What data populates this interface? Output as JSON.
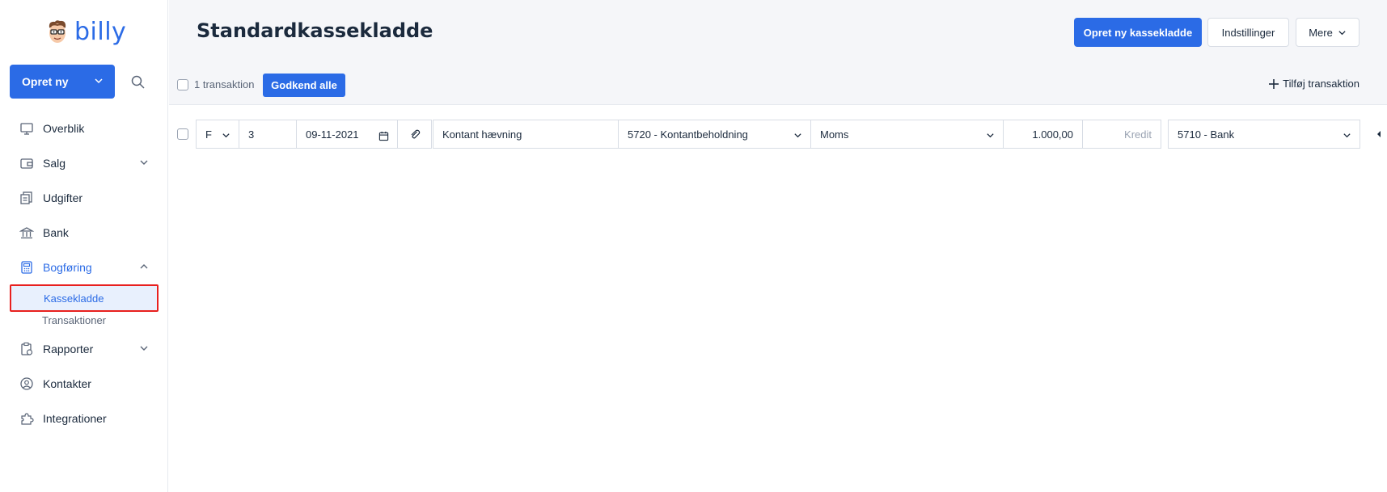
{
  "brand": {
    "name": "billy"
  },
  "sidebar": {
    "create_label": "Opret ny",
    "items": [
      {
        "label": "Overblik",
        "icon": "dashboard-icon"
      },
      {
        "label": "Salg",
        "icon": "wallet-icon"
      },
      {
        "label": "Udgifter",
        "icon": "receipts-icon"
      },
      {
        "label": "Bank",
        "icon": "bank-icon"
      },
      {
        "label": "Bogføring",
        "icon": "calculator-icon"
      },
      {
        "label": "Rapporter",
        "icon": "report-icon"
      },
      {
        "label": "Kontakter",
        "icon": "contact-icon"
      },
      {
        "label": "Integrationer",
        "icon": "puzzle-icon"
      }
    ],
    "subitems": [
      {
        "label": "Kassekladde"
      },
      {
        "label": "Transaktioner"
      }
    ]
  },
  "header": {
    "title": "Standardkassekladde",
    "new_button": "Opret ny kassekladde",
    "settings_button": "Indstillinger",
    "more_button": "Mere"
  },
  "toolbar": {
    "count_label": "1 transaktion",
    "approve_all": "Godkend alle",
    "add_transaction": "Tilføj transaktion"
  },
  "transaction": {
    "type": "F",
    "number": "3",
    "date": "09-11-2021",
    "description": "Kontant hævning",
    "account": "5720 - Kontantbeholdning",
    "vat": "Moms",
    "amount": "1.000,00",
    "side_placeholder": "Kredit",
    "contra_account": "5710 - Bank"
  },
  "colors": {
    "accent": "#2b6be6",
    "highlight_border": "#e8201e"
  }
}
